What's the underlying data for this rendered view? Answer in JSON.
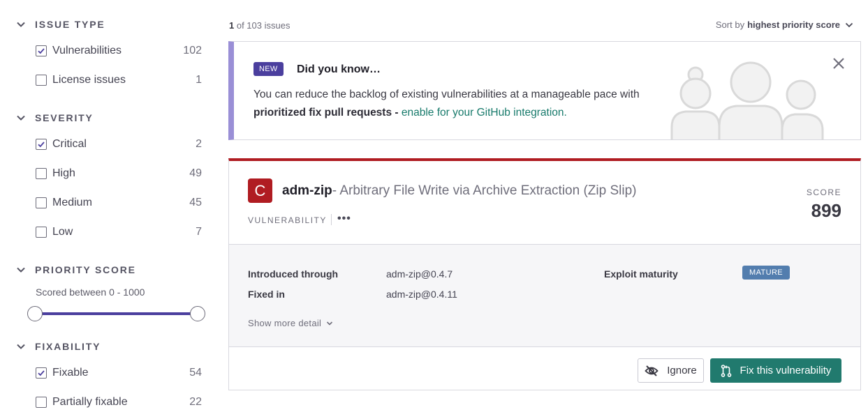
{
  "sidebar": {
    "issue_type": {
      "title": "ISSUE TYPE",
      "items": [
        {
          "label": "Vulnerabilities",
          "count": "102",
          "checked": true
        },
        {
          "label": "License issues",
          "count": "1",
          "checked": false
        }
      ]
    },
    "severity": {
      "title": "SEVERITY",
      "items": [
        {
          "label": "Critical",
          "count": "2",
          "checked": true
        },
        {
          "label": "High",
          "count": "49",
          "checked": false
        },
        {
          "label": "Medium",
          "count": "45",
          "checked": false
        },
        {
          "label": "Low",
          "count": "7",
          "checked": false
        }
      ]
    },
    "priority_score": {
      "title": "PRIORITY SCORE",
      "subtitle": "Scored between 0 - 1000",
      "range_min": 0,
      "range_max": 1000
    },
    "fixability": {
      "title": "FIXABILITY",
      "items": [
        {
          "label": "Fixable",
          "count": "54",
          "checked": true
        },
        {
          "label": "Partially fixable",
          "count": "22",
          "checked": false
        }
      ]
    }
  },
  "main": {
    "issue_count_current": "1",
    "issue_count_rest": " of 103 issues",
    "sort_prefix": "Sort by",
    "sort_value": "highest priority score",
    "banner": {
      "badge": "NEW",
      "title": "Did you know…",
      "text": "You can reduce the backlog of existing vulnerabilities at a manageable pace with",
      "bold": "prioritized fix pull requests",
      "dash": " - ",
      "link": "enable for your GitHub integration."
    },
    "issue": {
      "severity_letter": "C",
      "package": "adm-zip",
      "title": "- Arbitrary File Write via Archive Extraction (Zip Slip)",
      "type": "VULNERABILITY",
      "more": "•••",
      "score_label": "SCORE",
      "score": "899",
      "introduced_label": "Introduced through",
      "introduced_value": "adm-zip@0.4.7",
      "fixed_label": "Fixed in",
      "fixed_value": "adm-zip@0.4.11",
      "exploit_label": "Exploit maturity",
      "exploit_value": "MATURE",
      "show_more": "Show more detail",
      "ignore_label": "Ignore",
      "fix_label": "Fix this vulnerability"
    }
  },
  "colors": {
    "brand_purple": "#4b3f9e",
    "critical_red": "#b01c22",
    "teal": "#217a6e",
    "mature_blue": "#527dae"
  }
}
